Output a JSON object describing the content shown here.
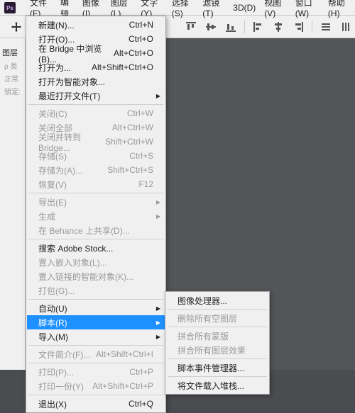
{
  "app": {
    "icon_label": "Ps"
  },
  "menubar": {
    "items": [
      "文件(F)",
      "编辑",
      "图像(I)",
      "图层(L)",
      "文字(Y)",
      "选择(S)",
      "滤镜(T)",
      "3D(D)",
      "视图(V)",
      "窗口(W)",
      "帮助(H)"
    ]
  },
  "left": {
    "panel_title": "图层",
    "hint1": "ρ 类",
    "hint2": "正常",
    "hint3": "锁定:"
  },
  "file_menu": {
    "items": [
      {
        "label": "新建(N)...",
        "shortcut": "Ctrl+N"
      },
      {
        "label": "打开(O)...",
        "shortcut": "Ctrl+O"
      },
      {
        "label": "在 Bridge 中浏览(B)...",
        "shortcut": "Alt+Ctrl+O"
      },
      {
        "label": "打开为...",
        "shortcut": "Alt+Shift+Ctrl+O"
      },
      {
        "label": "打开为智能对象...",
        "shortcut": ""
      },
      {
        "label": "最近打开文件(T)",
        "shortcut": "",
        "sub": true
      },
      {
        "sep": true
      },
      {
        "label": "关闭(C)",
        "shortcut": "Ctrl+W",
        "dim": true
      },
      {
        "label": "关闭全部",
        "shortcut": "Alt+Ctrl+W",
        "dim": true
      },
      {
        "label": "关闭并转到 Bridge...",
        "shortcut": "Shift+Ctrl+W",
        "dim": true
      },
      {
        "label": "存储(S)",
        "shortcut": "Ctrl+S",
        "dim": true
      },
      {
        "label": "存储为(A)...",
        "shortcut": "Shift+Ctrl+S",
        "dim": true
      },
      {
        "label": "恢复(V)",
        "shortcut": "F12",
        "dim": true
      },
      {
        "sep": true
      },
      {
        "label": "导出(E)",
        "shortcut": "",
        "sub": true,
        "dim": true
      },
      {
        "label": "生成",
        "shortcut": "",
        "sub": true,
        "dim": true
      },
      {
        "label": "在 Behance 上共享(D)...",
        "shortcut": "",
        "dim": true
      },
      {
        "sep": true
      },
      {
        "label": "搜索 Adobe Stock...",
        "shortcut": ""
      },
      {
        "label": "置入嵌入对象(L)...",
        "shortcut": "",
        "dim": true
      },
      {
        "label": "置入链接的智能对象(K)...",
        "shortcut": "",
        "dim": true
      },
      {
        "label": "打包(G)...",
        "shortcut": "",
        "dim": true
      },
      {
        "sep": true
      },
      {
        "label": "自动(U)",
        "shortcut": "",
        "sub": true
      },
      {
        "label": "脚本(R)",
        "shortcut": "",
        "sub": true,
        "highlight": true
      },
      {
        "label": "导入(M)",
        "shortcut": "",
        "sub": true
      },
      {
        "sep": true
      },
      {
        "label": "文件简介(F)...",
        "shortcut": "Alt+Shift+Ctrl+I",
        "dim": true
      },
      {
        "sep": true
      },
      {
        "label": "打印(P)...",
        "shortcut": "Ctrl+P",
        "dim": true
      },
      {
        "label": "打印一份(Y)",
        "shortcut": "Alt+Shift+Ctrl+P",
        "dim": true
      },
      {
        "sep": true
      },
      {
        "label": "退出(X)",
        "shortcut": "Ctrl+Q"
      }
    ]
  },
  "scripts_submenu": {
    "items": [
      {
        "label": "图像处理器...",
        "dim": false
      },
      {
        "sep": true
      },
      {
        "label": "删除所有空图层",
        "dim": true
      },
      {
        "sep": true
      },
      {
        "label": "拼合所有蒙版",
        "dim": true
      },
      {
        "label": "拼合所有图层效果",
        "dim": true
      },
      {
        "sep": true
      },
      {
        "label": "脚本事件管理器...",
        "dim": false
      },
      {
        "sep": true
      },
      {
        "label": "将文件载入堆栈...",
        "dim": false
      }
    ]
  }
}
